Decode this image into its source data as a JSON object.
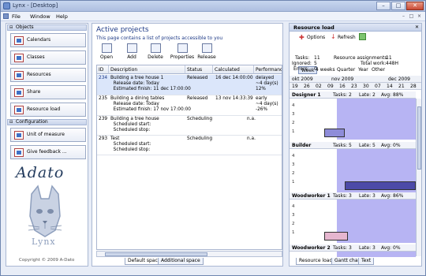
{
  "window": {
    "title": "Lynx - [Desktop]",
    "min": "–",
    "max": "□",
    "close": "✕"
  },
  "menu": {
    "file": "File",
    "window": "Window",
    "help": "Help"
  },
  "left": {
    "objects_header": "Objects",
    "config_header": "Configuration",
    "items": [
      "Calendars",
      "Classes",
      "Resources",
      "Share",
      "Resource load"
    ],
    "config_items": [
      "Unit of measure",
      "Give feedback ..."
    ],
    "logo": "Adato",
    "lynx": "Lynx",
    "copyright": "Copyright © 2009 A-Dato"
  },
  "center": {
    "title": "Active projects",
    "subtitle": "This page contains a list of projects accessible to you",
    "toolbar": [
      "Open",
      "Add",
      "Delete",
      "Properties",
      "Release"
    ],
    "columns": [
      "ID",
      "Description",
      "Status",
      "Calculated finish",
      "Performance"
    ],
    "rows": [
      {
        "id": "234",
        "desc": "Building a tree house 1\n  Release date: Today\n  Estimated finish: 11 dec 17:00:00",
        "status": "Released",
        "finish": "16 dec 14:00:00",
        "perf": "delayed\n~4 day(s)\n12%"
      },
      {
        "id": "235",
        "desc": "Building a dining tables\n  Release date: Today\n  Estimated finish: 17 nov 17:00:00",
        "status": "Released",
        "finish": "13 nov 14:33:39",
        "perf": "early\n~4 day(s)\n-26%"
      },
      {
        "id": "239",
        "desc": "Building a tree house\n  Scheduled start:\n  Scheduled stop:",
        "status": "Scheduling",
        "finish": "n.a.",
        "perf": ""
      },
      {
        "id": "293",
        "desc": "Test\n  Scheduled start:\n  Scheduled stop:",
        "status": "Scheduling",
        "finish": "n.a.",
        "perf": ""
      }
    ],
    "tabs": [
      "Default space",
      "Additional space"
    ]
  },
  "right": {
    "title": "Resource load",
    "options": "Options",
    "refresh": "Refresh",
    "periods": [
      "Week",
      "4 weeks",
      "Quarter",
      "Year",
      "Other"
    ],
    "stats": {
      "tasks_label": "Tasks:",
      "tasks": "11",
      "ignored_label": "Ignored:",
      "ignored": "5",
      "errors_label": "Errors:",
      "errors": "0",
      "assign_label": "Resource assignments:",
      "assign": "11",
      "work_label": "Total work:",
      "work": "448H"
    },
    "months": [
      "okt 2009",
      "nov 2009",
      "dec 2009"
    ],
    "weeks": [
      "19",
      "26",
      "02",
      "09",
      "16",
      "23",
      "30",
      "07",
      "14",
      "21",
      "28"
    ],
    "resources": [
      {
        "name": "Designer 1",
        "tasks": "Tasks: 2",
        "late": "Late: 2",
        "avg": "Avg: 88%"
      },
      {
        "name": "Builder",
        "tasks": "Tasks: 5",
        "late": "Late: 5",
        "avg": "Avg: 0%"
      },
      {
        "name": "Woodworker 1",
        "tasks": "Tasks: 3",
        "late": "Late: 3",
        "avg": "Avg: 86%"
      },
      {
        "name": "Woodworker 2",
        "tasks": "Tasks: 3",
        "late": "Late: 3",
        "avg": "Avg: 0%"
      }
    ],
    "yticks": [
      "4",
      "3",
      "2",
      "1"
    ],
    "tabs": [
      "Resource load",
      "Gantt chart",
      "Text"
    ]
  }
}
